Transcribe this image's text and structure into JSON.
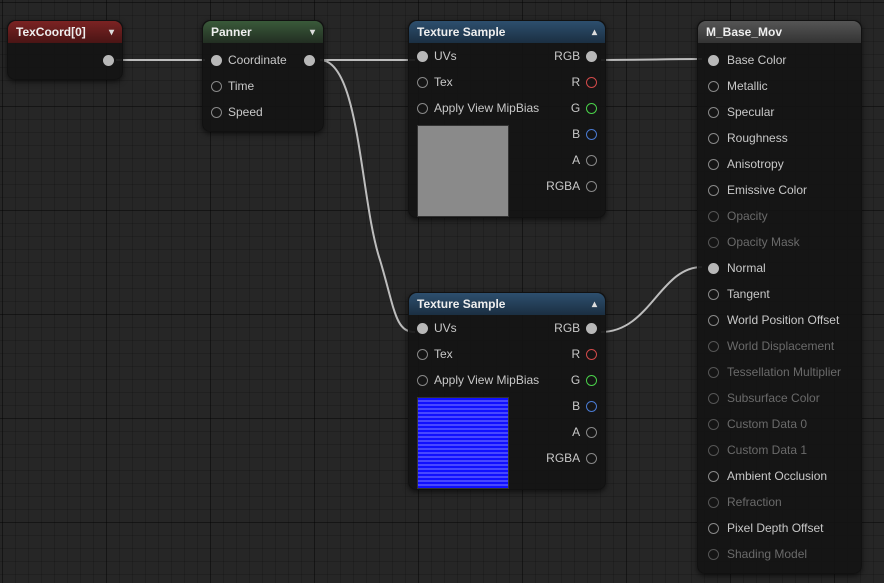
{
  "texcoord": {
    "title": "TexCoord[0]"
  },
  "panner": {
    "title": "Panner",
    "inputs": [
      "Coordinate",
      "Time",
      "Speed"
    ]
  },
  "texsample1": {
    "title": "Texture Sample",
    "inputs": {
      "uvs": "UVs",
      "tex": "Tex",
      "mip": "Apply View MipBias"
    },
    "outputs": {
      "rgb": "RGB",
      "r": "R",
      "g": "G",
      "b": "B",
      "a": "A",
      "rgba": "RGBA"
    }
  },
  "texsample2": {
    "title": "Texture Sample",
    "inputs": {
      "uvs": "UVs",
      "tex": "Tex",
      "mip": "Apply View MipBias"
    },
    "outputs": {
      "rgb": "RGB",
      "r": "R",
      "g": "G",
      "b": "B",
      "a": "A",
      "rgba": "RGBA"
    }
  },
  "material": {
    "title": "M_Base_Mov",
    "pins": [
      {
        "label": "Base Color",
        "dim": false
      },
      {
        "label": "Metallic",
        "dim": false
      },
      {
        "label": "Specular",
        "dim": false
      },
      {
        "label": "Roughness",
        "dim": false
      },
      {
        "label": "Anisotropy",
        "dim": false
      },
      {
        "label": "Emissive Color",
        "dim": false
      },
      {
        "label": "Opacity",
        "dim": true
      },
      {
        "label": "Opacity Mask",
        "dim": true
      },
      {
        "label": "Normal",
        "dim": false
      },
      {
        "label": "Tangent",
        "dim": false
      },
      {
        "label": "World Position Offset",
        "dim": false
      },
      {
        "label": "World Displacement",
        "dim": true
      },
      {
        "label": "Tessellation Multiplier",
        "dim": true
      },
      {
        "label": "Subsurface Color",
        "dim": true
      },
      {
        "label": "Custom Data 0",
        "dim": true
      },
      {
        "label": "Custom Data 1",
        "dim": true
      },
      {
        "label": "Ambient Occlusion",
        "dim": false
      },
      {
        "label": "Refraction",
        "dim": true
      },
      {
        "label": "Pixel Depth Offset",
        "dim": false
      },
      {
        "label": "Shading Model",
        "dim": true
      }
    ]
  }
}
